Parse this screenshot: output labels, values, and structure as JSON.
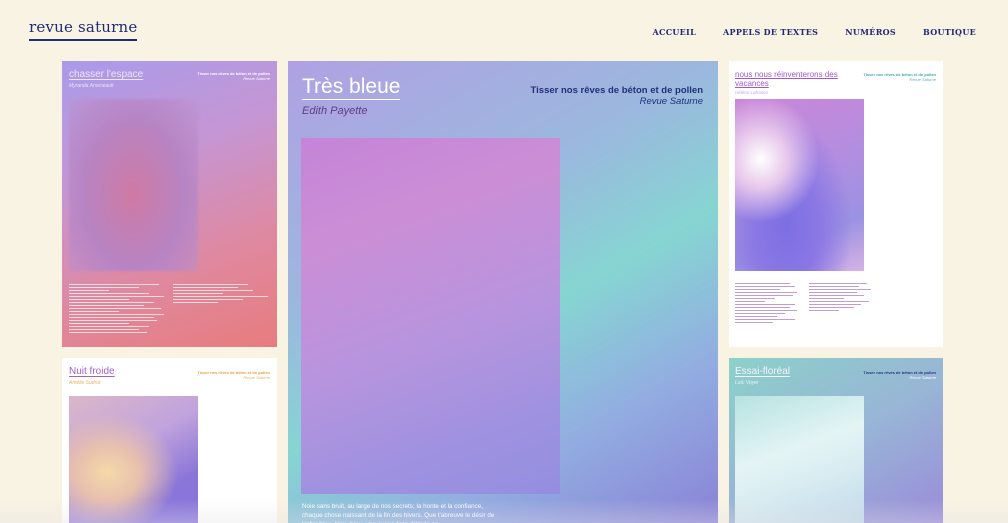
{
  "header": {
    "brand": "revue saturne",
    "nav": [
      "ACCUEIL",
      "APPELS DE TEXTES",
      "NUMÉROS",
      "BOUTIQUE"
    ]
  },
  "cards": [
    {
      "title": "chasser l'espace",
      "author": "Myranda Arseneault",
      "collection": "Tisser nos rêves de béton et de pollen",
      "publisher": "Revue Saturne"
    },
    {
      "title": "Très bleue",
      "author": "Edith Payette",
      "collection": "Tisser nos rêves de béton et de pollen",
      "publisher": "Revue Saturne",
      "excerpt": "Noie sans bruit, au large de nos secrets; la honte et la confiance, chaque chose naissant de la fin des hivers. Que t'abreuve le désir de l'infini bleu, bleu, bleu, une suave tinte d'étoile en"
    },
    {
      "title": "nous nous réinventerons des vacances",
      "author": "Hélène Lafrance",
      "collection": "Tisser nos rêves de béton et de pollen",
      "publisher": "Revue Saturne"
    },
    {
      "title": "Nuit froide",
      "author": "Amélie Sudrot",
      "collection": "Tisser nos rêves de béton et de pollen",
      "publisher": "Revue Saturne"
    },
    {
      "title": "Essai-floréal",
      "author": "Loïc Voyer",
      "collection": "Tisser nos rêves de béton et de pollen",
      "publisher": "Revue Saturne"
    }
  ],
  "colors": {
    "background": "#f8f3e2",
    "accent": "#1f2a78"
  }
}
